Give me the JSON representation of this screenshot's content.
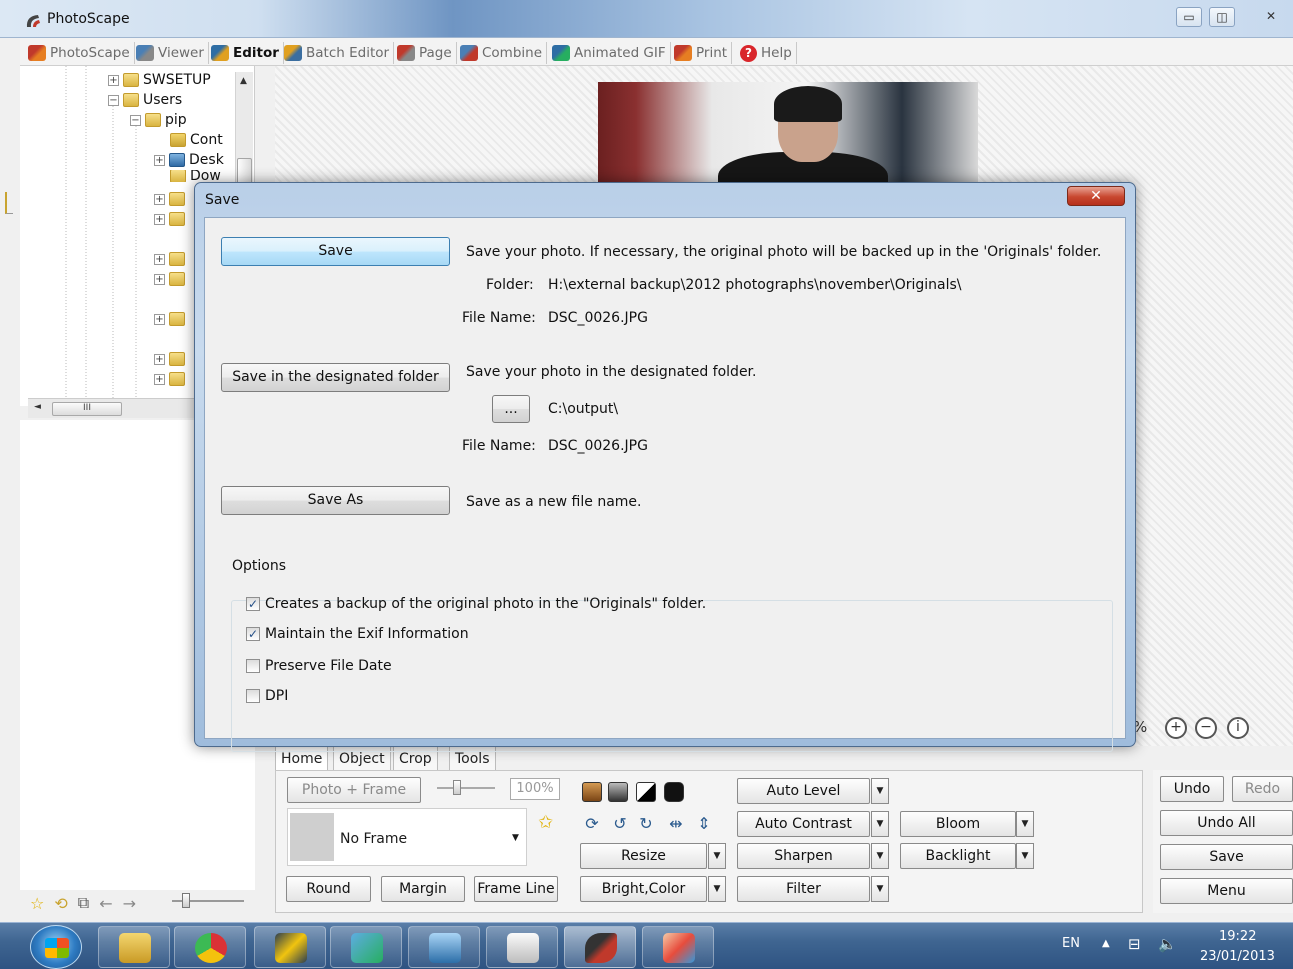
{
  "window": {
    "title": "PhotoScape",
    "min": "▭",
    "max": "◫",
    "close": "✕"
  },
  "menu": [
    {
      "label": "PhotoScape"
    },
    {
      "label": "Viewer"
    },
    {
      "label": "Editor"
    },
    {
      "label": "Batch Editor"
    },
    {
      "label": "Page"
    },
    {
      "label": "Combine"
    },
    {
      "label": "Animated GIF"
    },
    {
      "label": "Print"
    },
    {
      "label": "Help"
    }
  ],
  "tree": {
    "swsetup": "SWSETUP",
    "users": "Users",
    "pip": "pip",
    "cont": "Cont",
    "desk": "Desk",
    "dow": "Dow",
    "scrollbar_thumb": "III"
  },
  "dialog": {
    "title": "Save",
    "close": "✕",
    "save_button": "Save",
    "save_description": "Save your photo. If necessary, the original photo will be backed up in the 'Originals' folder.",
    "folder_label": "Folder:",
    "folder_value": "H:\\external backup\\2012 photographs\\november\\Originals\\",
    "file_name_label": "File Name:",
    "file_name_value": "DSC_0026.JPG",
    "designated_button": "Save in the designated folder",
    "designated_description": "Save your photo in the designated folder.",
    "browse_button": "...",
    "designated_folder": "C:\\output\\",
    "designated_file_label": "File Name:",
    "designated_file_value": "DSC_0026.JPG",
    "save_as_button": "Save As",
    "save_as_description": "Save as a new file name.",
    "options_label": "Options",
    "options": [
      {
        "label": "Creates a backup of the original photo in the \"Originals\" folder.",
        "checked": true
      },
      {
        "label": "Maintain the Exif Information",
        "checked": true
      },
      {
        "label": "Preserve File Date",
        "checked": false
      },
      {
        "label": "DPI",
        "checked": false
      }
    ]
  },
  "zoom_percent_fragment": "%",
  "editor": {
    "tabs": [
      "Home",
      "Object",
      "Crop",
      "Tools"
    ],
    "photo_frame": "Photo + Frame",
    "zoom_value": "100%",
    "frame_select": "No Frame",
    "round": "Round",
    "margin": "Margin",
    "frame_line": "Frame Line",
    "resize": "Resize",
    "bright_color": "Bright,Color",
    "auto_level": "Auto Level",
    "auto_contrast": "Auto Contrast",
    "sharpen": "Sharpen",
    "filter": "Filter",
    "bloom": "Bloom",
    "backlight": "Backlight",
    "undo": "Undo",
    "redo": "Redo",
    "undo_all": "Undo All",
    "save": "Save",
    "menu": "Menu"
  },
  "taskbar": {
    "language": "EN",
    "time": "19:22",
    "date": "23/01/2013"
  }
}
